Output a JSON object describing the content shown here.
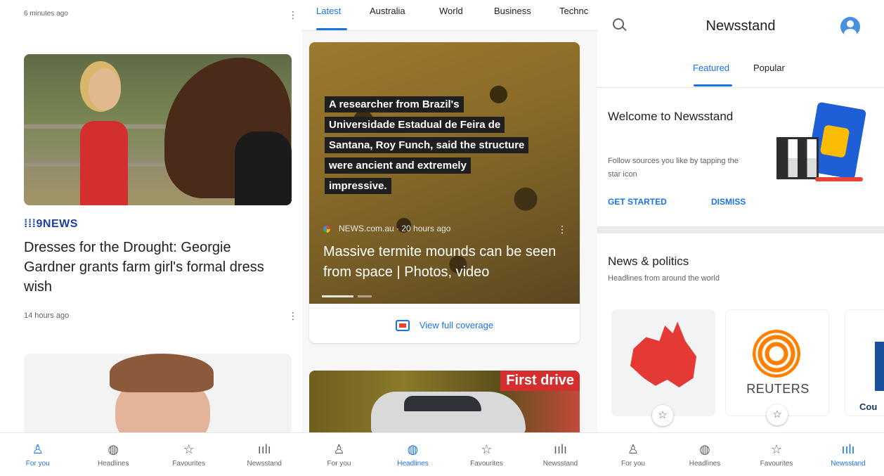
{
  "colors": {
    "accent": "#1a73e8",
    "brand_9news": "#1a3fa8",
    "first_drive_red": "#d32f2f"
  },
  "nav": [
    {
      "label": "For you",
      "icon": "person-icon"
    },
    {
      "label": "Headlines",
      "icon": "globe-icon"
    },
    {
      "label": "Favourites",
      "icon": "star-icon"
    },
    {
      "label": "Newsstand",
      "icon": "newsstand-icon"
    }
  ],
  "panel1": {
    "time_top": "6 minutes ago",
    "brand": "9NEWS",
    "headline": "Dresses for the Drought: Georgie Gardner grants farm girl's formal dress wish",
    "time": "14 hours ago",
    "active_nav": "For you"
  },
  "panel2": {
    "tabs": [
      "Latest",
      "Australia",
      "World",
      "Business",
      "Technc"
    ],
    "active_tab": "Latest",
    "quote": [
      "A researcher from Brazil's",
      "Universidade Estadual de Feira de",
      "Santana, Roy Funch, said the structure",
      "were ancient and extremely",
      "impressive."
    ],
    "source": "NEWS.com.au · 20 hours ago",
    "headline": "Massive termite mounds can be seen from space | Photos, video",
    "coverage_label": "View full coverage",
    "first_drive": "First drive",
    "active_nav": "Headlines"
  },
  "panel3": {
    "title": "Newsstand",
    "tabs": [
      "Featured",
      "Popular"
    ],
    "active_tab": "Featured",
    "welcome_title": "Welcome to Newsstand",
    "welcome_sub": "Follow sources you like by tapping the star icon",
    "get_started": "GET STARTED",
    "dismiss": "DISMISS",
    "section_title": "News & politics",
    "section_sub": "Headlines from around the world",
    "reuters": "REUTERS",
    "third_source": "Cou",
    "active_nav": "Newsstand"
  }
}
